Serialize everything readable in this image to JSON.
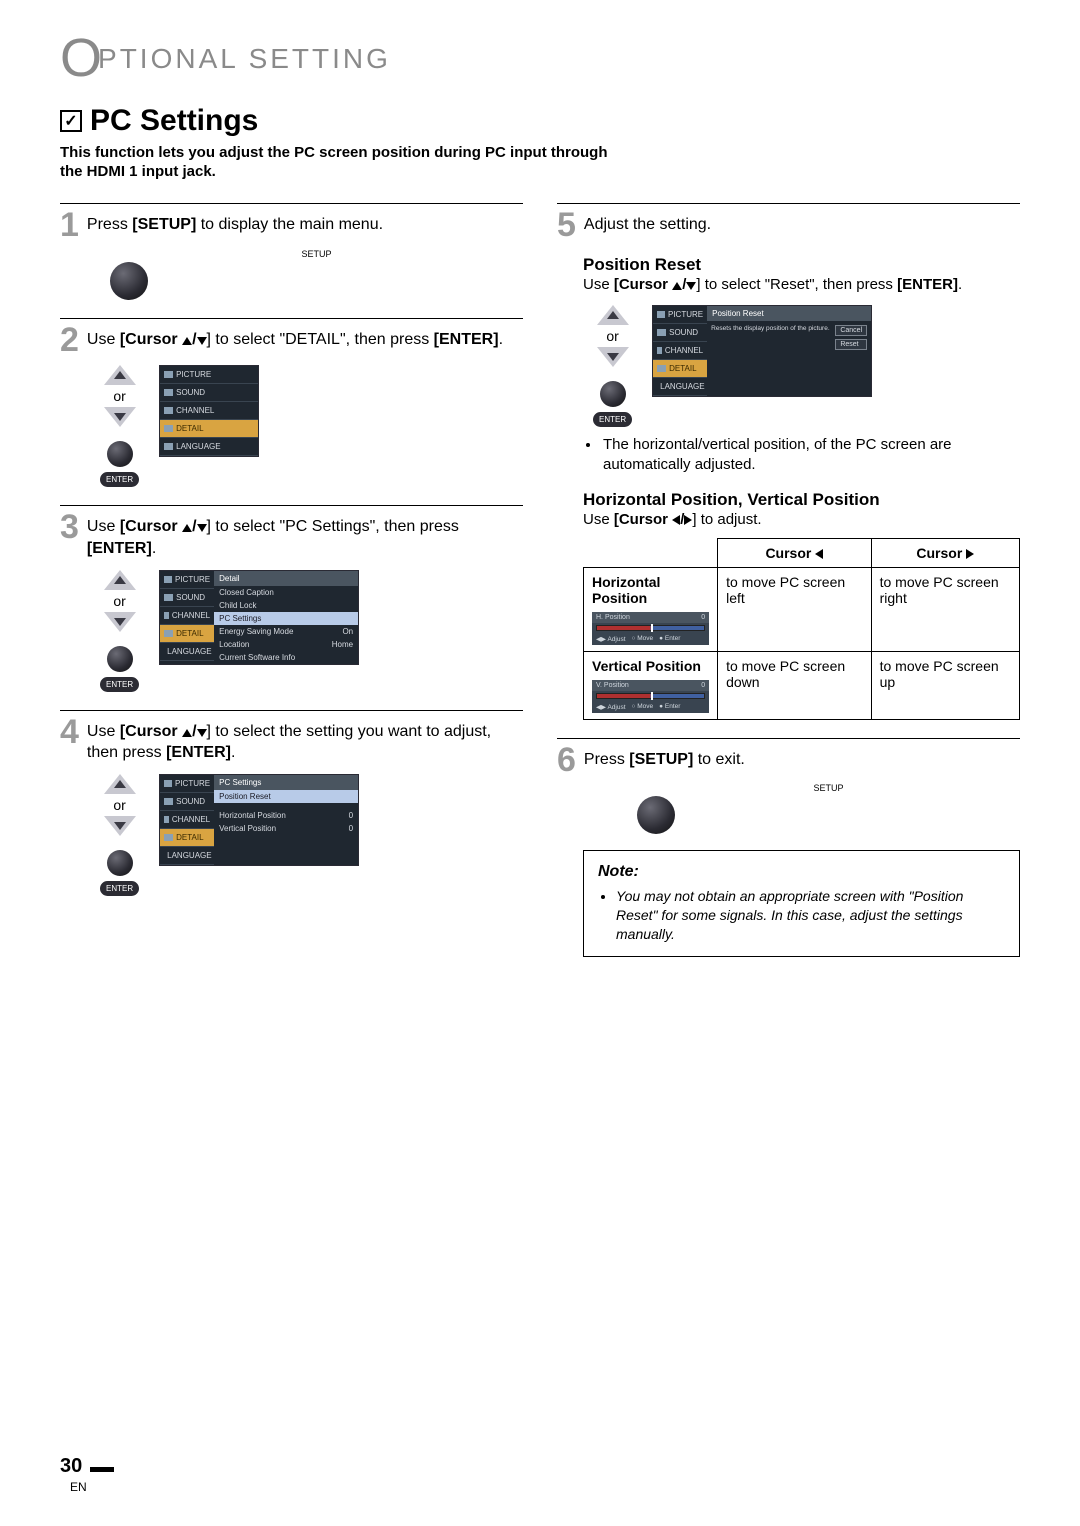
{
  "header": {
    "letter": "O",
    "rest": "PTIONAL   SETTING"
  },
  "title": {
    "checkmark": "✓",
    "text": "PC Settings"
  },
  "subtitle": "This function lets you adjust the PC screen position during PC input through the HDMI 1 input jack.",
  "labels": {
    "setup": "SETUP",
    "or": "or",
    "enter": "ENTER",
    "setup_word": "SETUP",
    "enter_word": "ENTER",
    "cursor": "Cursor"
  },
  "steps": {
    "s1": {
      "num": "1",
      "pre": "Press ",
      "b1": "[SETUP]",
      "post": " to display the main menu."
    },
    "s2": {
      "num": "2",
      "pre": "Use ",
      "b1": "[Cursor ",
      "mid": "] to select \"DETAIL\", then press ",
      "b2": "[ENTER]",
      "post": "."
    },
    "s3": {
      "num": "3",
      "pre": "Use ",
      "b1": "[Cursor ",
      "mid": "] to select \"PC Settings\", then press ",
      "b2": "[ENTER]",
      "post": "."
    },
    "s4": {
      "num": "4",
      "pre": "Use ",
      "b1": "[Cursor ",
      "mid": "] to select the setting you want to adjust, then press ",
      "b2": "[ENTER]",
      "post": "."
    },
    "s5": {
      "num": "5",
      "text": "Adjust the setting."
    },
    "s6": {
      "num": "6",
      "pre": "Press ",
      "b1": "[SETUP]",
      "post": " to exit."
    }
  },
  "section5": {
    "h1": "Position Reset",
    "p1a": "Use ",
    "p1b": "[Cursor ",
    "p1c": "] to select \"Reset\", then press ",
    "p1d": "[ENTER]",
    "p1e": ".",
    "bullet": "The horizontal/vertical position, of the PC screen are automatically adjusted.",
    "h2": "Horizontal Position, Vertical Position",
    "p2a": "Use ",
    "p2b": "[Cursor ",
    "p2c": "] to adjust."
  },
  "osd": {
    "menu1": {
      "items": [
        "PICTURE",
        "SOUND",
        "CHANNEL",
        "DETAIL",
        "LANGUAGE"
      ],
      "sel": 3
    },
    "detail": {
      "title": "Detail",
      "rows": [
        {
          "l": "Closed Caption",
          "r": ""
        },
        {
          "l": "Child Lock",
          "r": ""
        },
        {
          "l": "PC Settings",
          "r": "",
          "sel": true
        },
        {
          "l": "Energy Saving Mode",
          "r": "On"
        },
        {
          "l": "Location",
          "r": "Home"
        },
        {
          "l": "Current Software Info",
          "r": ""
        }
      ]
    },
    "pcset": {
      "title": "PC Settings",
      "rows": [
        {
          "l": "Position Reset",
          "r": "",
          "sel": true
        },
        {
          "l": "Horizontal Position",
          "r": "0"
        },
        {
          "l": "Vertical Position",
          "r": "0"
        }
      ]
    },
    "posreset": {
      "title": "Position Reset",
      "desc": "Resets the display position of the picture.",
      "btns": [
        "Cancel",
        "Reset"
      ]
    },
    "slider": {
      "h": {
        "label": "H. Position",
        "val": "0",
        "adjust": "Adjust",
        "move": "Move",
        "enter": "Enter"
      },
      "v": {
        "label": "V. Position",
        "val": "0",
        "adjust": "Adjust",
        "move": "Move",
        "enter": "Enter"
      }
    }
  },
  "table": {
    "th0": "",
    "th1": "Cursor ",
    "th2": "Cursor ",
    "r1": {
      "label": "Horizontal Position",
      "c1": "to move PC screen left",
      "c2": "to move PC screen right"
    },
    "r2": {
      "label": "Vertical Position",
      "c1": "to move PC screen down",
      "c2": "to move PC screen up"
    }
  },
  "note": {
    "title": "Note:",
    "text": "You may not obtain an appropriate screen with \"Position Reset\" for some signals. In this case, adjust the settings manually."
  },
  "page_num": "30",
  "lang": "EN"
}
